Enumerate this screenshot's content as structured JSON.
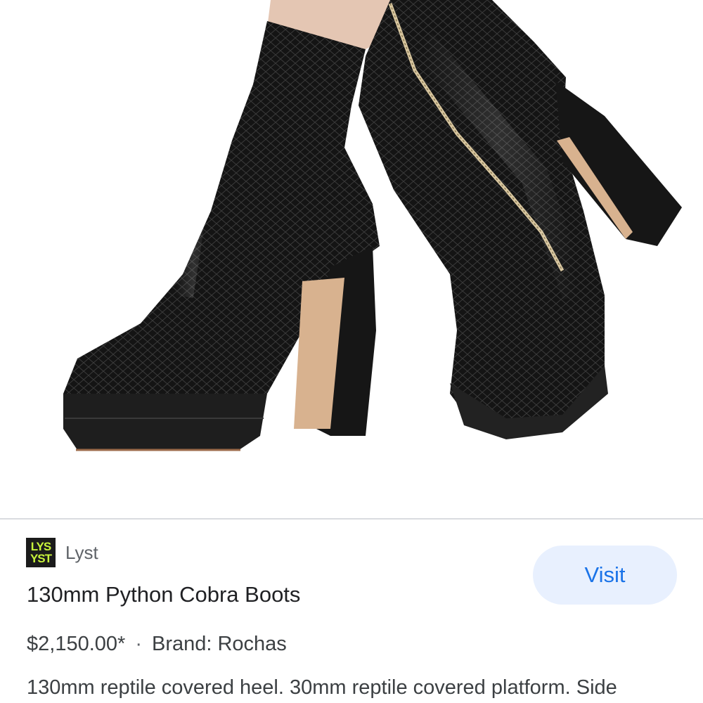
{
  "product_image": {
    "alt": "130mm Python Cobra Boots"
  },
  "source": {
    "logo_text_top": "LYS",
    "logo_text_bottom": "YST",
    "name": "Lyst",
    "logo_color": "#c7f23b"
  },
  "visit_button": {
    "label": "Visit"
  },
  "product": {
    "title": "130mm Python Cobra Boots",
    "price": "$2,150.00*",
    "separator": "·",
    "brand": "Brand: Rochas",
    "description": "130mm reptile covered heel. 30mm reptile covered platform. Side"
  }
}
